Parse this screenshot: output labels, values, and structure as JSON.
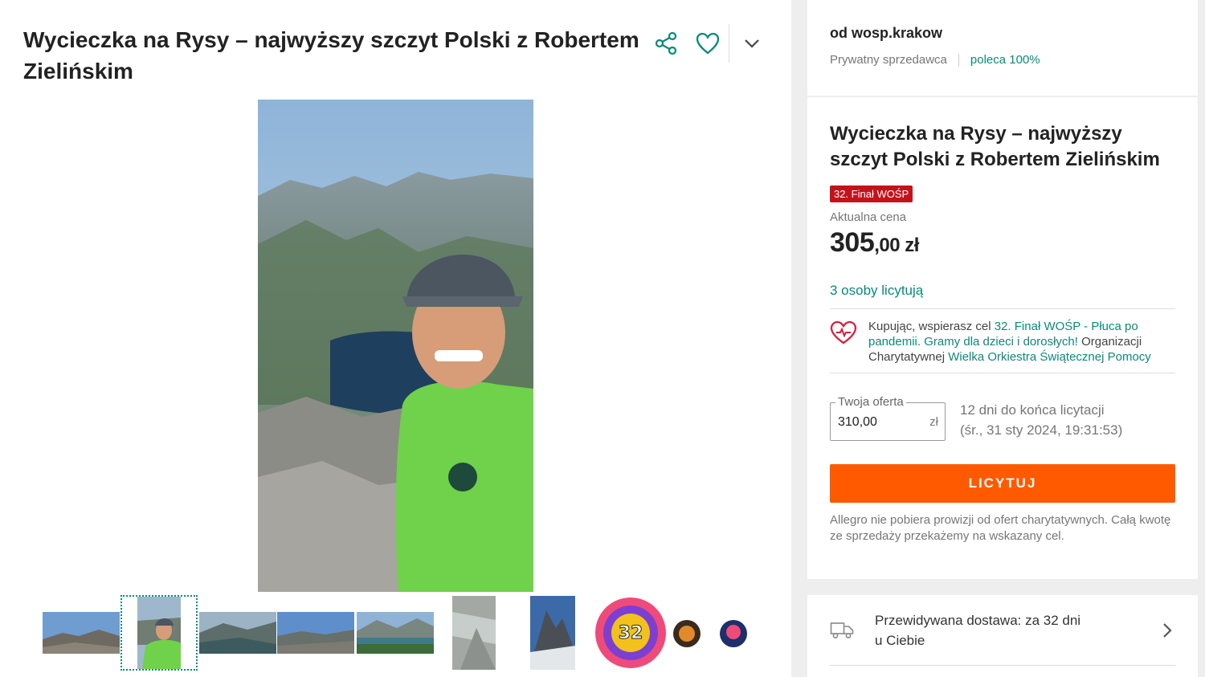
{
  "listing": {
    "title": "Wycieczka na Rysy – najwyższy szczyt Polski z Robertem Zielińskim"
  },
  "actions": {
    "share_icon": "share-icon",
    "favorite_icon": "heart-icon",
    "more_icon": "chevron-down-icon"
  },
  "gallery": {
    "thumbnails": [
      {
        "name": "thumbnail-1"
      },
      {
        "name": "thumbnail-2",
        "selected": true
      },
      {
        "name": "thumbnail-3"
      },
      {
        "name": "thumbnail-4"
      },
      {
        "name": "thumbnail-5"
      },
      {
        "name": "thumbnail-6"
      },
      {
        "name": "thumbnail-7"
      },
      {
        "name": "thumbnail-8"
      }
    ],
    "logo_text": "32"
  },
  "seller": {
    "name": "od wosp.krakow",
    "type": "Prywatny sprzedawca",
    "recommend": "poleca 100%"
  },
  "offer": {
    "title": "Wycieczka na Rysy – najwyższy szczyt Polski z Robertem Zielińskim",
    "badge": "32. Finał WOŚP",
    "price_label": "Aktualna cena",
    "price_main": "305",
    "price_fraction": ",00 zł",
    "bidders": "3 osoby licytują"
  },
  "charity": {
    "text1": "Kupując, wspierasz cel ",
    "goal": "32. Finał WOŚP - Płuca po pandemii. Gramy dla dzieci i dorosłych!",
    "text2": " Organizacji Charytatywnej ",
    "org": "Wielka Orkiestra Świątecznej Pomocy"
  },
  "bid": {
    "legend": "Twoja oferta",
    "value": "310,00",
    "currency": "zł",
    "deadline_line1": "12 dni do końca licytacji",
    "deadline_line2": "(śr., 31 sty 2024, 19:31:53)",
    "button": "LICYTUJ",
    "note": "Allegro nie pobiera prowizji od ofert charytatywnych. Całą kwotę ze sprzedaży przekażemy na wskazany cel."
  },
  "delivery": {
    "line1": "Przewidywana dostawa: za 32 dni",
    "line2": "u Ciebie"
  },
  "colors": {
    "accent_green": "#0a8a7a",
    "buy_orange": "#ff5a00",
    "badge_red": "#c4121b"
  }
}
